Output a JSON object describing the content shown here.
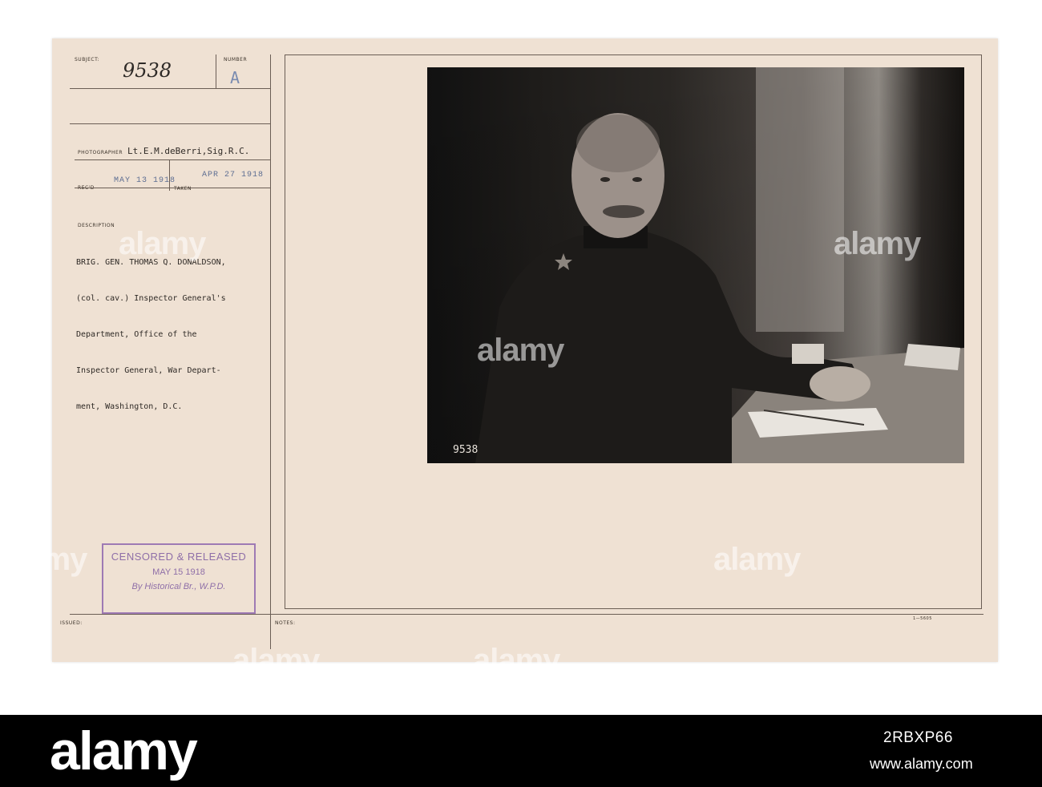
{
  "card": {
    "subject_label": "SUBJECT:",
    "subject_value": "9538",
    "number_label": "NUMBER",
    "number_value": "A",
    "photographer_label": "PHOTOGRAPHER",
    "photographer_value": "Lt.E.M.deBerri,Sig.R.C.",
    "recd_label": "REC'D",
    "recd_date": "MAY 13 1918",
    "taken_date": "APR 27 1918",
    "taken_label": "TAKEN",
    "description_label": "DESCRIPTION",
    "description_lines": [
      "BRIG. GEN. THOMAS Q. DONALDSON,",
      "(col. cav.) Inspector General's",
      "Department, Office of the",
      "Inspector General, War Depart-",
      "ment, Washington, D.C."
    ],
    "censor": {
      "line1": "CENSORED & RELEASED",
      "line2": "MAY 15 1918",
      "line3": "By Historical Br., W.P.D."
    },
    "issued_label": "ISSUED:",
    "notes_label": "NOTES:",
    "form_number": "1—5605",
    "photo_number": "9538"
  },
  "watermarks": [
    "alamy",
    "alamy",
    "alamy",
    "alamy",
    "alamy",
    "alamy",
    "alamy"
  ],
  "footer": {
    "brand": "alamy",
    "image_id": "2RBXP66",
    "url": "www.alamy.com"
  }
}
